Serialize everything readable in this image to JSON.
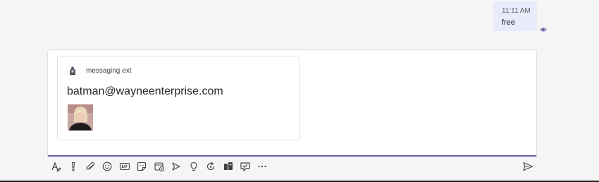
{
  "message": {
    "time": "11:11 AM",
    "text": "free",
    "seen_icon": "eye-icon"
  },
  "card": {
    "app_name": "messaging ext",
    "app_icon": "bot-app-icon",
    "title": "batman@wayneenterprise.com",
    "image": "person-photo"
  },
  "toolbar": {
    "icons": [
      "format-icon",
      "important-icon",
      "attach-icon",
      "emoji-icon",
      "gif-icon",
      "sticker-icon",
      "schedule-meeting-icon",
      "stream-icon",
      "praise-icon",
      "loop-icon",
      "apps-icon",
      "approval-icon",
      "more-options-icon"
    ],
    "send_icon": "send-icon"
  },
  "colors": {
    "accent": "#6264a7",
    "bubble": "#e8ebfa",
    "background": "#f5f5f5",
    "icon": "#424242"
  }
}
